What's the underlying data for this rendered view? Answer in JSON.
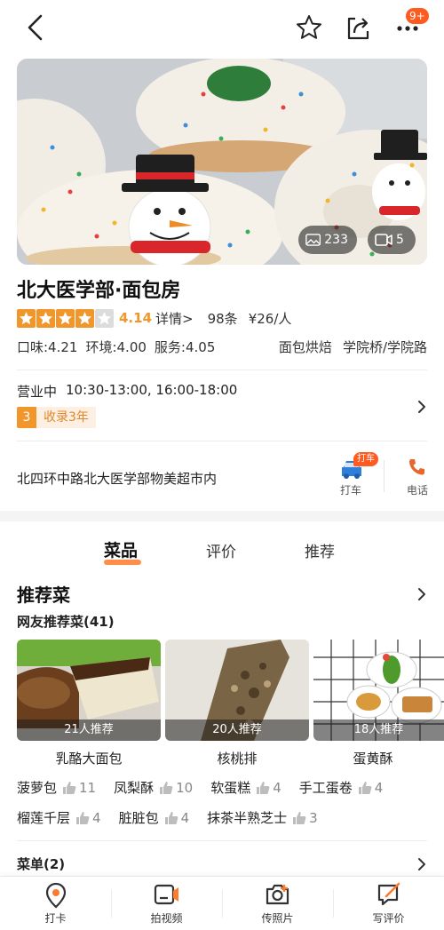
{
  "header": {
    "notification_badge": "9+",
    "icons": [
      "back-arrow-icon",
      "star-outline-icon",
      "share-icon",
      "more-icon"
    ]
  },
  "gallery": {
    "photo_count": "233",
    "video_count": "5"
  },
  "shop": {
    "name": "北大医学部·面包房",
    "rating": "4.14",
    "rating_stars_value": 4.14,
    "details_link": "详情>",
    "review_count": "98条",
    "price_per_person": "¥26/人",
    "scores": [
      "口味:4.21",
      "环境:4.00",
      "服务:4.05"
    ],
    "tags": [
      "面包烘焙",
      "学院桥/学院路"
    ],
    "hours_status": "营业中",
    "hours": "10:30-13:00, 16:00-18:00",
    "listed_badge_num": "3",
    "listed_badge_text": "收录3年",
    "address": "北四环中路北大医学部物美超市内",
    "taxi_badge": "打车",
    "taxi_label": "打车",
    "phone_label": "电话"
  },
  "tabs": [
    {
      "label": "菜品",
      "active": true
    },
    {
      "label": "评价",
      "active": false
    },
    {
      "label": "推荐",
      "active": false
    }
  ],
  "recommended": {
    "title": "推荐菜",
    "subtitle": "网友推荐菜(41)",
    "dishes": [
      {
        "caption": "21人推荐",
        "name": "乳酪大面包"
      },
      {
        "caption": "20人推荐",
        "name": "核桃排"
      },
      {
        "caption": "18人推荐",
        "name": "蛋黄酥"
      }
    ],
    "chips_row1": [
      {
        "name": "菠萝包",
        "count": "11"
      },
      {
        "name": "凤梨酥",
        "count": "10"
      },
      {
        "name": "软蛋糕",
        "count": "4"
      },
      {
        "name": "手工蛋卷",
        "count": "4"
      }
    ],
    "chips_row2": [
      {
        "name": "榴莲千层",
        "count": "4"
      },
      {
        "name": "脏脏包",
        "count": "4"
      },
      {
        "name": "抹茶半熟芝士",
        "count": "3"
      }
    ]
  },
  "menu_section": {
    "title": "菜单(2)"
  },
  "bottom_nav": [
    {
      "label": "打卡",
      "icon": "location-pin-icon"
    },
    {
      "label": "拍视频",
      "icon": "video-camera-icon"
    },
    {
      "label": "传照片",
      "icon": "camera-plus-icon"
    },
    {
      "label": "写评价",
      "icon": "write-review-icon"
    }
  ],
  "colors": {
    "accent_orange": "#ff7a2a",
    "star_orange": "#f0962b",
    "badge_red": "#ff5a1f",
    "phone_orange": "#e8662a",
    "taxi_blue": "#2f7fd8"
  }
}
